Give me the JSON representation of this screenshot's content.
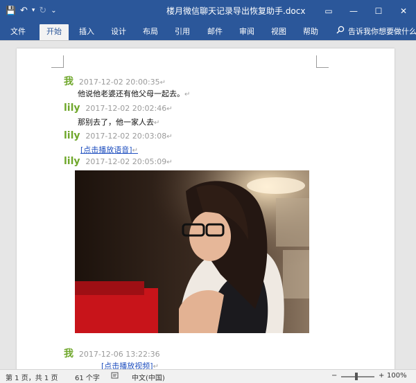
{
  "window": {
    "title": "楼月微信聊天记录导出恢复助手.docx",
    "buttons": {
      "restore": "▭",
      "minimize": "—",
      "maximize": "☐",
      "close": "✕"
    }
  },
  "qat": {
    "save": "💾",
    "undo": "↶",
    "undo_menu": "▾",
    "redo": "↻",
    "customize": "⌄"
  },
  "ribbon": {
    "tabs": [
      {
        "label": "文件"
      },
      {
        "label": "开始"
      },
      {
        "label": "插入"
      },
      {
        "label": "设计"
      },
      {
        "label": "布局"
      },
      {
        "label": "引用"
      },
      {
        "label": "邮件"
      },
      {
        "label": "审阅"
      },
      {
        "label": "视图"
      },
      {
        "label": "帮助"
      }
    ],
    "active_tab": "开始",
    "tell_me": "告诉我你想要做什么",
    "tell_me_icon": "search-icon"
  },
  "document": {
    "paragraph_mark": "↵",
    "messages": [
      {
        "sender": "我",
        "time": "2017-12-02 20:00:35",
        "text": "他说他老婆还有他父母一起去。"
      },
      {
        "sender": "lily",
        "time": "2017-12-02 20:02:46",
        "text": "那别去了，他一家人去"
      },
      {
        "sender": "lily",
        "time": "2017-12-02 20:03:08",
        "link": "[点击播放语音]"
      },
      {
        "sender": "lily",
        "time": "2017-12-02 20:05:09"
      },
      {
        "sender": "我",
        "time": "2017-12-06 13:22:36",
        "link": "[点击播放视频]"
      }
    ]
  },
  "statusbar": {
    "page": "第 1 页，共 1 页",
    "words": "61 个字",
    "language": "中文(中国)",
    "zoom_minus": "−",
    "zoom_plus": "+",
    "zoom": "100%"
  },
  "colors": {
    "ribbon": "#2b579a",
    "sender": "#6fa72b",
    "link": "#1f4fbf"
  }
}
